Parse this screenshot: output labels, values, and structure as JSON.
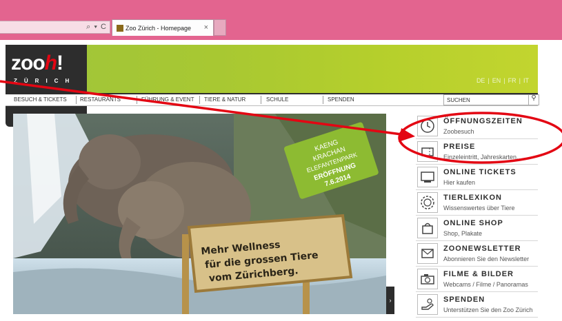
{
  "browser": {
    "address_controls": "⌕ ▾ C",
    "tab_title": "Zoo Zürich - Homepage",
    "tab_close": "×"
  },
  "site": {
    "logo_text": "zoo",
    "logo_h": "h",
    "logo_bang": "!",
    "logo_sub": "ZÜRICH",
    "languages": [
      "DE",
      "EN",
      "FR",
      "IT"
    ]
  },
  "nav": {
    "items": [
      "BESUCH & TICKETS",
      "RESTAURANTS",
      "FÜHRUNG & EVENT",
      "TIERE & NATUR",
      "SCHULE",
      "SPENDEN"
    ],
    "search_label": "SUCHEN"
  },
  "hero": {
    "badge": {
      "line1": "KAENG",
      "line2": "KRACHAN",
      "line3": "ELEFANTENPARK",
      "line4": "ERÖFFNUNG",
      "line5": "7.6.2014"
    },
    "sign": {
      "line1": "Mehr Wellness",
      "line2": "für die grossen Tiere",
      "line3": "vom Zürichberg."
    },
    "next_arrow": "›"
  },
  "sidebar": {
    "items": [
      {
        "title": "ÖFFNUNGSZEITEN",
        "sub": "Zoobesuch",
        "icon": "clock-icon"
      },
      {
        "title": "PREISE",
        "sub": "Einzeleintritt, Jahreskarten...",
        "icon": "ticket-icon"
      },
      {
        "title": "ONLINE TICKETS",
        "sub": "Hier kaufen",
        "icon": "online-ticket-icon"
      },
      {
        "title": "TIERLEXIKON",
        "sub": "Wissenswertes über Tiere",
        "icon": "lion-icon"
      },
      {
        "title": "ONLINE SHOP",
        "sub": "Shop, Plakate",
        "icon": "bag-icon"
      },
      {
        "title": "ZOONEWSLETTER",
        "sub": "Abonnieren Sie den Newsletter",
        "icon": "newsletter-icon"
      },
      {
        "title": "FILME & BILDER",
        "sub": "Webcams / Filme / Panoramas",
        "icon": "camera-icon"
      },
      {
        "title": "SPENDEN",
        "sub": "Unterstützen Sie den Zoo Zürich",
        "icon": "donate-hand-icon"
      }
    ]
  },
  "colors": {
    "browser_bar": "#e3648f",
    "brand_green": "#a8c832",
    "dark": "#2d2d2d",
    "annotation_red": "#e30613"
  }
}
